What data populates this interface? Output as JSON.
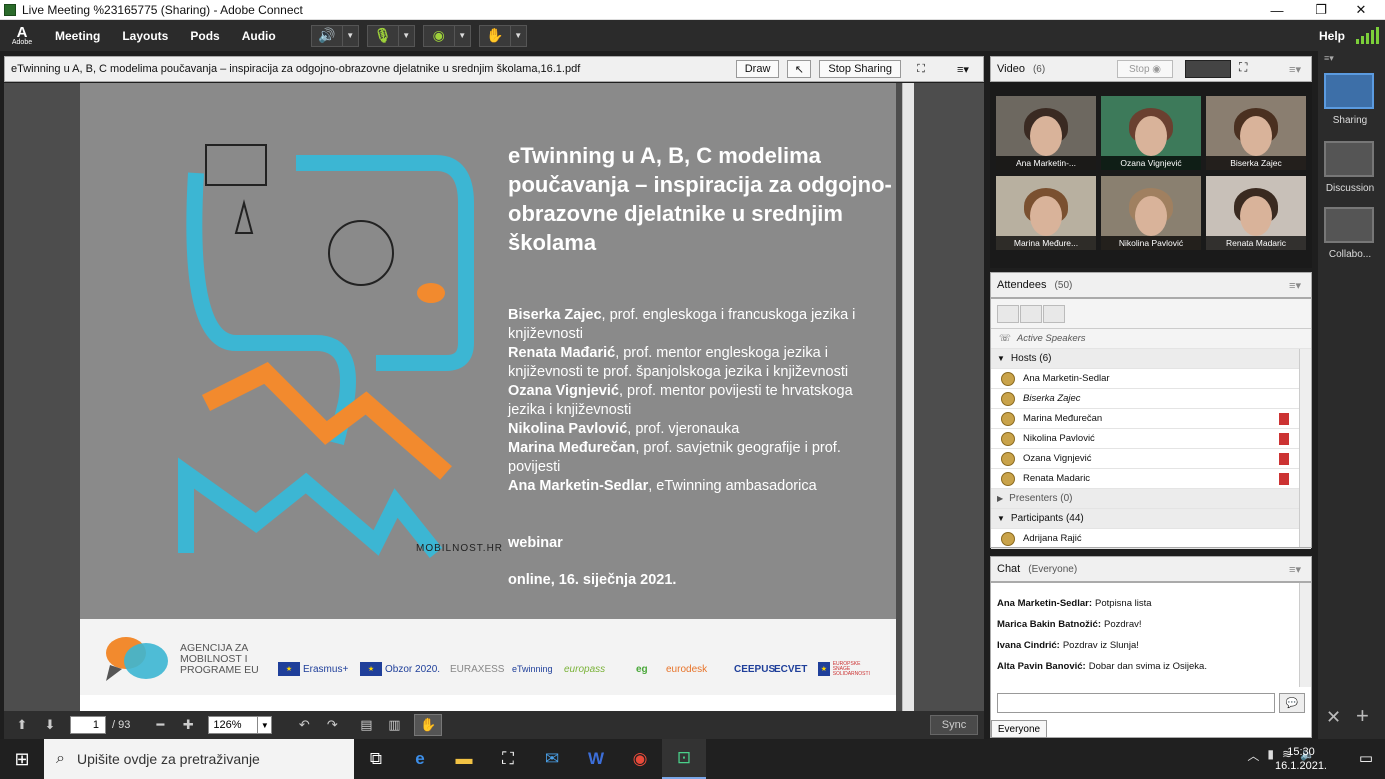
{
  "window": {
    "title": "Live Meeting %23165775 (Sharing) - Adobe Connect"
  },
  "menu": {
    "logo": "Adobe",
    "items": [
      "Meeting",
      "Layouts",
      "Pods",
      "Audio"
    ],
    "help": "Help"
  },
  "share": {
    "filename": "eTwinning u A, B, C modelima poučavanja – inspiracija za odgojno-obrazovne djelatnike u srednjim školama,16.1.pdf",
    "draw_label": "Draw",
    "stop_sharing_label": "Stop Sharing",
    "page": "1",
    "page_total": "/ 93",
    "zoom": "126%",
    "sync_label": "Sync"
  },
  "slide": {
    "title": "eTwinning u A, B, C modelima poučavanja – inspiracija za odgojno-obrazovne djelatnike u srednjim školama",
    "authors": [
      {
        "name": "Biserka Zajec",
        "desc": ", prof. engleskoga i francuskoga jezika i književnosti"
      },
      {
        "name": "Renata Mađarić",
        "desc": ", prof. mentor engleskoga jezika i književnosti te prof. španjolskoga jezika i književnosti"
      },
      {
        "name": "Ozana Vignjević",
        "desc": ", prof. mentor povijesti te hrvatskoga jezika i književnosti"
      },
      {
        "name": "Nikolina Pavlović",
        "desc": ", prof. vjeronauka"
      },
      {
        "name": "Marina Međurečan",
        "desc": ", prof. savjetnik geografije i prof. povijesti"
      },
      {
        "name": "Ana Marketin-Sedlar",
        "desc": ", eTwinning ambasadorica"
      }
    ],
    "webinar": "webinar",
    "date": "online, 16. siječnja 2021.",
    "mobilnost": "MOBILNOST.HR",
    "agency": [
      "AGENCIJA ZA",
      "MOBILNOST I",
      "PROGRAME EU"
    ],
    "footer_logos": [
      "Erasmus+",
      "Obzor 2020.",
      "EURAXESS",
      "eTwinning",
      "europass",
      "eg",
      "eurodesk",
      "CEEPUS",
      "ECVET",
      "EUROPSKE SNAGE SOLIDARNOSTI"
    ]
  },
  "video": {
    "title": "Video",
    "count": "(6)",
    "stop_label": "Stop",
    "tiles": [
      "Ana Marketin-...",
      "Ozana Vignjević",
      "Biserka Zajec",
      "Marina Međure...",
      "Nikolina Pavlović",
      "Renata Madaric"
    ]
  },
  "attendees": {
    "title": "Attendees",
    "count": "(50)",
    "active_speakers": "Active Speakers",
    "hosts_label": "Hosts (6)",
    "hosts": [
      "Ana Marketin-Sedlar",
      "Biserka Zajec",
      "Marina Međurečan",
      "Nikolina Pavlović",
      "Ozana Vignjević",
      "Renata Madaric"
    ],
    "presenters_label": "Presenters (0)",
    "participants_label": "Participants (44)",
    "participants": [
      "Adrijana Rajić"
    ]
  },
  "chat": {
    "title": "Chat",
    "scope": "(Everyone)",
    "messages": [
      {
        "from": "Ana Marketin-Sedlar:",
        "text": "Potpisna lista"
      },
      {
        "from": "Marica Bakin Batnožić:",
        "text": "Pozdrav!"
      },
      {
        "from": "Ivana Cindrić:",
        "text": "Pozdrav iz Slunja!"
      },
      {
        "from": "Alta Pavin Banović:",
        "text": "Dobar dan svima iz Osijeka."
      }
    ],
    "tab": "Everyone"
  },
  "layouts": [
    "Sharing",
    "Discussion",
    "Collabo..."
  ],
  "taskbar": {
    "search_placeholder": "Upišite ovdje za pretraživanje",
    "time": "15:30",
    "date": "16.1.2021."
  },
  "colors": {
    "slide_bg": "#8a8a8a",
    "teal": "#3cb6d3",
    "orange": "#f28a2e",
    "accent": "#5b9be0"
  }
}
